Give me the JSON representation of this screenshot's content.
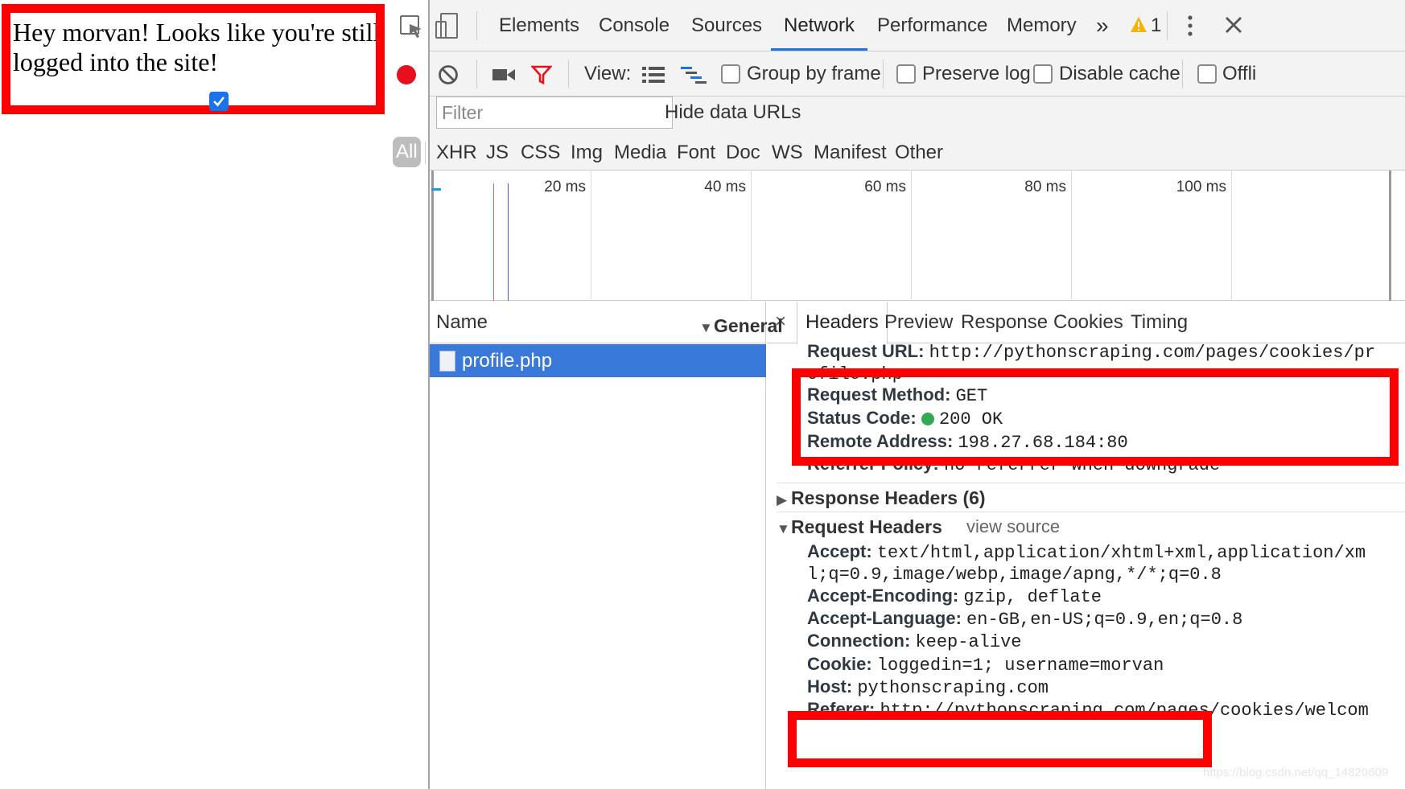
{
  "page": {
    "message": "Hey morvan! Looks like you're still logged into the site!"
  },
  "devtools": {
    "tabs": [
      "Elements",
      "Console",
      "Sources",
      "Network",
      "Performance",
      "Memory"
    ],
    "active_tab": "Network",
    "more_tabs_glyph": "»",
    "warning_count": "1",
    "toolbar": {
      "view_label": "View:",
      "group_by_frame": "Group by frame",
      "preserve_log": "Preserve log",
      "disable_cache": "Disable cache",
      "offline": "Offli"
    },
    "filter": {
      "placeholder": "Filter",
      "hide_data_urls": "Hide data URLs"
    },
    "type_filters": [
      "All",
      "XHR",
      "JS",
      "CSS",
      "Img",
      "Media",
      "Font",
      "Doc",
      "WS",
      "Manifest",
      "Other"
    ],
    "timeline_ticks": [
      "20 ms",
      "40 ms",
      "60 ms",
      "80 ms",
      "100 ms"
    ],
    "requests": {
      "column_name": "Name",
      "items": [
        "profile.php"
      ]
    },
    "detail": {
      "close_glyph": "×",
      "tabs": [
        "Headers",
        "Preview",
        "Response",
        "Cookies",
        "Timing"
      ],
      "general": {
        "title": "General",
        "request_url_key": "Request URL:",
        "request_url_line1": "http://pythonscraping.com/pages/cookies/pr",
        "request_url_line2": "ofile.php",
        "request_method_key": "Request Method:",
        "request_method": "GET",
        "status_code_key": "Status Code:",
        "status_code": "200 OK",
        "remote_address_key": "Remote Address:",
        "remote_address": "198.27.68.184:80",
        "referrer_policy_key": "Referrer Policy:",
        "referrer_policy": "no-referrer-when-downgrade"
      },
      "response_headers": {
        "title": "Response Headers (6)"
      },
      "request_headers": {
        "title": "Request Headers",
        "view_source": "view source",
        "accept_key": "Accept:",
        "accept_line1": "text/html,application/xhtml+xml,application/xm",
        "accept_line2": "l;q=0.9,image/webp,image/apng,*/*;q=0.8",
        "accept_encoding_key": "Accept-Encoding:",
        "accept_encoding": "gzip, deflate",
        "accept_language_key": "Accept-Language:",
        "accept_language": "en-GB,en-US;q=0.9,en;q=0.8",
        "connection_key": "Connection:",
        "connection": "keep-alive",
        "cookie_key": "Cookie:",
        "cookie": "loggedin=1; username=morvan",
        "host_key": "Host:",
        "host": "pythonscraping.com",
        "referer_key": "Referer:",
        "referer": "http://pythonscraping.com/pages/cookies/welcom"
      }
    }
  },
  "watermark": "https://blog.csdn.net/qq_14820609",
  "colors": {
    "highlight_red": "#ff0000",
    "record_red": "#e8101c",
    "selected_row": "#3879d9",
    "active_tab_underline": "#1a73e8"
  }
}
